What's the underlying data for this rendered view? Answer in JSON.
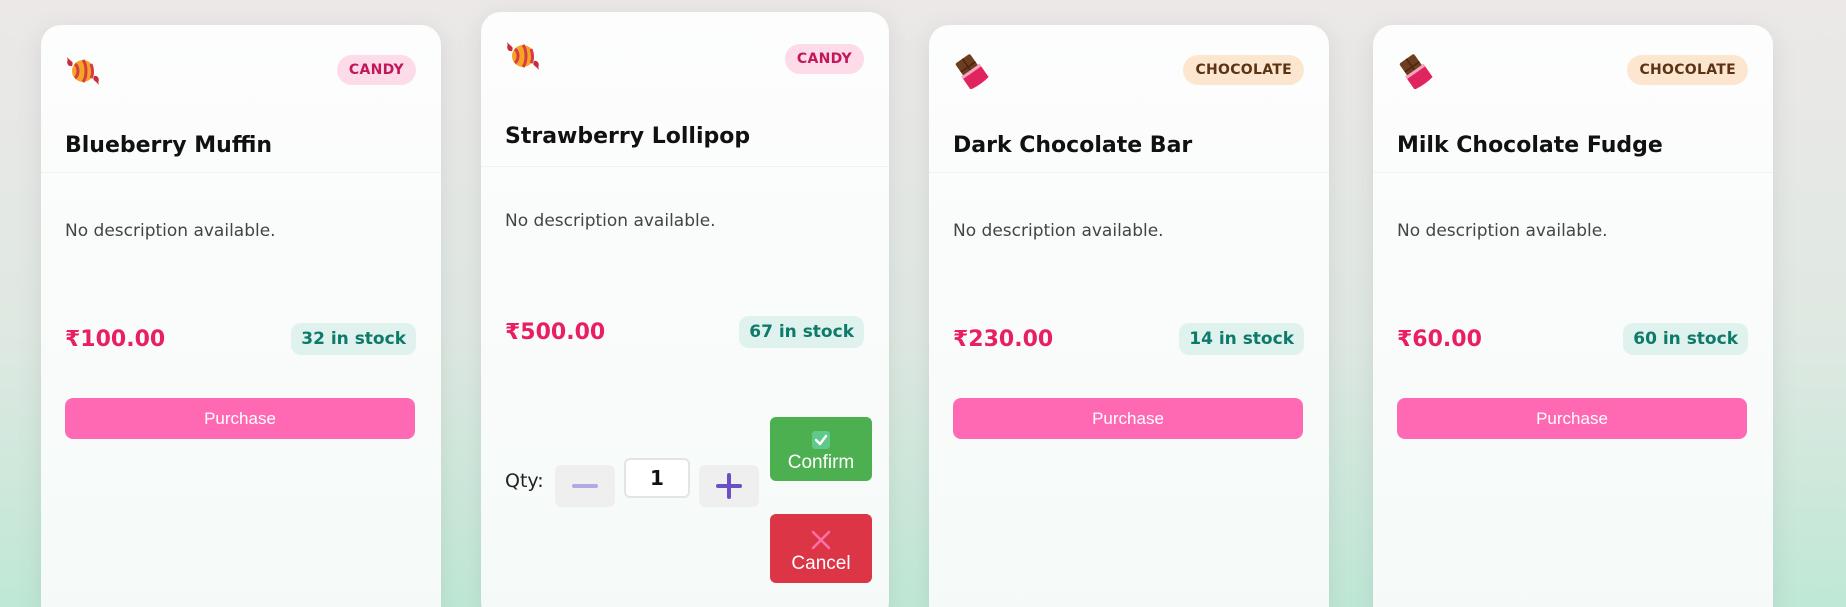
{
  "currency": "₹",
  "colors": {
    "candy_badge_bg": "#fddbe8",
    "candy_badge_text": "#c2185b",
    "chocolate_badge_bg": "#fde6cf",
    "chocolate_badge_text": "#5a3414",
    "price": "#e91e63",
    "stock_bg": "#dff2ee",
    "stock_text": "#0d7a6a",
    "purchase_button": "#ff69b4",
    "confirm_button": "#4caf50",
    "cancel_button": "#dc3545"
  },
  "products": [
    {
      "icon": "candy-icon",
      "category": "CANDY",
      "name": "Blueberry Muffin",
      "description": "No description available.",
      "price": "₹100.00",
      "stock": "32 in stock",
      "purchase_label": "Purchase"
    },
    {
      "icon": "candy-icon",
      "category": "CANDY",
      "name": "Strawberry Lollipop",
      "description": "No description available.",
      "price": "₹500.00",
      "stock": "67 in stock",
      "qty_label": "Qty:",
      "qty_value": "1",
      "confirm_label": "Confirm",
      "cancel_label": "Cancel"
    },
    {
      "icon": "chocolate-bar-icon",
      "category": "CHOCOLATE",
      "name": "Dark Chocolate Bar",
      "description": "No description available.",
      "price": "₹230.00",
      "stock": "14 in stock",
      "purchase_label": "Purchase"
    },
    {
      "icon": "chocolate-bar-icon",
      "category": "CHOCOLATE",
      "name": "Milk Chocolate Fudge",
      "description": "No description available.",
      "price": "₹60.00",
      "stock": "60 in stock",
      "purchase_label": "Purchase"
    }
  ]
}
